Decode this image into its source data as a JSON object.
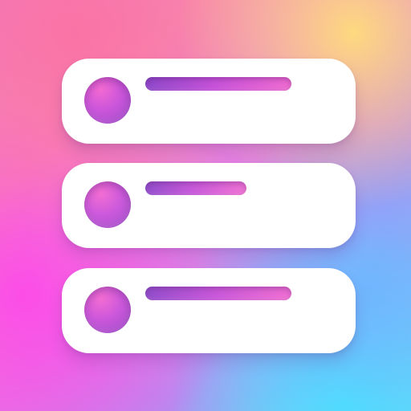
{
  "icon": {
    "name": "list-widget-app-icon",
    "rows": [
      {
        "name": "row-1",
        "line_style": "long"
      },
      {
        "name": "row-2",
        "line_style": "short"
      },
      {
        "name": "row-3",
        "line_style": "long"
      }
    ],
    "colors": {
      "gradient_top_left": "#f07bc2",
      "gradient_top_right": "#ffe07a",
      "gradient_mid_left": "#fd4ae9",
      "gradient_bottom_right": "#42ebff",
      "card": "#ffffff",
      "accent_purple": "#8e46ca",
      "accent_pink": "#f06bd1"
    }
  }
}
